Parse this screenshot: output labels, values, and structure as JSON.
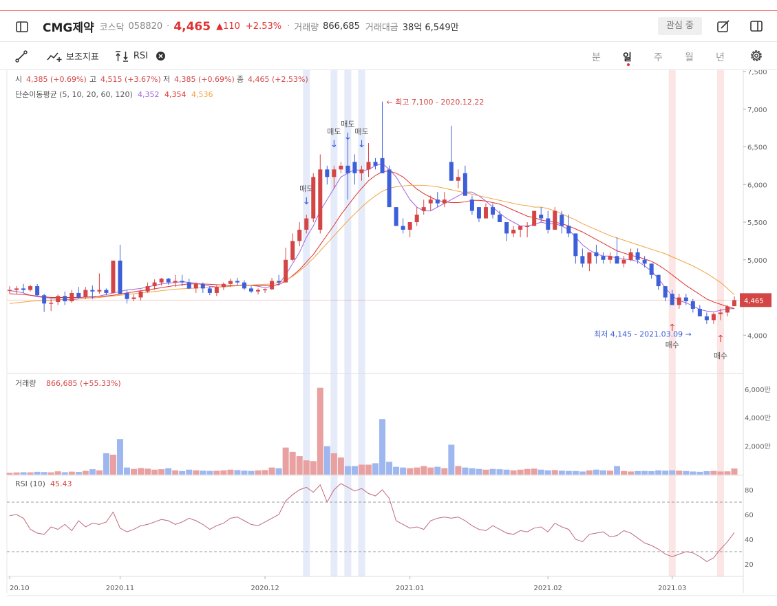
{
  "header": {
    "name": "CMG제약",
    "market": "코스닥",
    "code": "058820",
    "sep": "·",
    "price": "4,465",
    "change": "▲110",
    "change_pct": "+2.53%",
    "sep2": "·",
    "volume_label": "거래량",
    "volume_value": "866,685",
    "amount_label": "거래대금",
    "amount_value": "38억 6,549만",
    "interest_label": "관심 중"
  },
  "toolbar": {
    "indicator_label": "보조지표",
    "rsi_label": "RSI",
    "periods": [
      "분",
      "일",
      "주",
      "월",
      "년"
    ],
    "active_period": "일"
  },
  "ohlc_line": {
    "open_label": "시",
    "open_value": "4,385 (+0.69%)",
    "high_label": "고",
    "high_value": "4,515 (+3.67%)",
    "low_label": "저",
    "low_value": "4,385 (+0.69%)",
    "close_label": "종",
    "close_value": "4,465 (+2.53%)"
  },
  "ma_line": {
    "label": "단순이동평균 (5, 10, 20, 60, 120)",
    "values": [
      "4,352",
      "4,354",
      "4,536"
    ],
    "colors": [
      "#a064e0",
      "#e03131",
      "#f0a440"
    ]
  },
  "volume_header": {
    "label": "거래량",
    "value": "866,685 (+55.33%)"
  },
  "rsi_header": {
    "label": "RSI (10)",
    "value": "45.43"
  },
  "chart_data": {
    "type": "candlestick",
    "price_axis": {
      "ticks": [
        4000,
        4500,
        5000,
        5500,
        6000,
        6500,
        7000,
        7500
      ],
      "tick_labels": [
        "4,000",
        "4,500",
        "5,000",
        "5,500",
        "6,000",
        "6,500",
        "7,000",
        "7,500"
      ],
      "range": [
        3500,
        7500
      ],
      "current_label": "4,465"
    },
    "volume_axis": {
      "ticks": [
        2000,
        4000,
        6000
      ],
      "tick_labels": [
        "2,000만",
        "4,000만",
        "6,000만"
      ],
      "range": [
        0,
        7100
      ]
    },
    "rsi_axis": {
      "ticks": [
        20,
        40,
        60,
        80
      ],
      "tick_labels": [
        "20",
        "40",
        "60",
        "80"
      ],
      "range": [
        10,
        90
      ],
      "bands": [
        30,
        70
      ]
    },
    "x_labels": [
      {
        "i": 0,
        "text": "20.10"
      },
      {
        "i": 16,
        "text": "2020.11"
      },
      {
        "i": 37,
        "text": "2020.12"
      },
      {
        "i": 58,
        "text": "2021.01"
      },
      {
        "i": 78,
        "text": "2021.02"
      },
      {
        "i": 96,
        "text": "2021.03"
      }
    ],
    "candles": [
      [
        4600,
        4650,
        4550,
        4600,
        120
      ],
      [
        4600,
        4650,
        4550,
        4620,
        150
      ],
      [
        4620,
        4680,
        4560,
        4600,
        170
      ],
      [
        4600,
        4670,
        4580,
        4650,
        160
      ],
      [
        4650,
        4680,
        4520,
        4530,
        200
      ],
      [
        4530,
        4550,
        4310,
        4420,
        180
      ],
      [
        4420,
        4480,
        4320,
        4430,
        160
      ],
      [
        4440,
        4540,
        4400,
        4520,
        230
      ],
      [
        4520,
        4580,
        4400,
        4450,
        170
      ],
      [
        4450,
        4600,
        4430,
        4560,
        210
      ],
      [
        4560,
        4640,
        4490,
        4500,
        190
      ],
      [
        4500,
        4640,
        4480,
        4600,
        260
      ],
      [
        4600,
        4660,
        4480,
        4580,
        380
      ],
      [
        4580,
        4820,
        4550,
        4600,
        300
      ],
      [
        4600,
        4620,
        4530,
        4560,
        1500
      ],
      [
        4560,
        4900,
        4550,
        4990,
        1400
      ],
      [
        4990,
        5200,
        4550,
        4550,
        2500
      ],
      [
        4560,
        4600,
        4420,
        4480,
        500
      ],
      [
        4480,
        4540,
        4450,
        4500,
        400
      ],
      [
        4500,
        4600,
        4460,
        4580,
        460
      ],
      [
        4580,
        4700,
        4560,
        4650,
        420
      ],
      [
        4650,
        4740,
        4600,
        4700,
        350
      ],
      [
        4700,
        4760,
        4660,
        4750,
        380
      ],
      [
        4750,
        4760,
        4670,
        4700,
        450
      ],
      [
        4700,
        4800,
        4640,
        4720,
        300
      ],
      [
        4720,
        4800,
        4650,
        4700,
        250
      ],
      [
        4700,
        4750,
        4610,
        4620,
        350
      ],
      [
        4620,
        4700,
        4560,
        4680,
        300
      ],
      [
        4680,
        4700,
        4560,
        4620,
        280
      ],
      [
        4620,
        4650,
        4530,
        4560,
        260
      ],
      [
        4560,
        4660,
        4520,
        4640,
        270
      ],
      [
        4640,
        4700,
        4600,
        4680,
        300
      ],
      [
        4680,
        4750,
        4640,
        4720,
        350
      ],
      [
        4720,
        4760,
        4660,
        4700,
        320
      ],
      [
        4700,
        4730,
        4600,
        4620,
        280
      ],
      [
        4620,
        4650,
        4560,
        4580,
        260
      ],
      [
        4580,
        4620,
        4540,
        4600,
        300
      ],
      [
        4600,
        4620,
        4560,
        4610,
        320
      ],
      [
        4610,
        4760,
        4600,
        4720,
        500
      ],
      [
        4720,
        4800,
        4660,
        4700,
        450
      ],
      [
        4700,
        5160,
        4700,
        5000,
        1900
      ],
      [
        5000,
        5350,
        4980,
        5250,
        1600
      ],
      [
        5250,
        5500,
        5180,
        5400,
        1300
      ],
      [
        5400,
        5600,
        5350,
        5550,
        1000
      ],
      [
        5550,
        6150,
        5500,
        6100,
        950
      ],
      [
        5400,
        6400,
        5350,
        6200,
        6100
      ],
      [
        6200,
        6250,
        6000,
        6100,
        2000
      ],
      [
        6100,
        6250,
        5950,
        6200,
        1500
      ],
      [
        6200,
        6300,
        6150,
        6250,
        1200
      ],
      [
        6250,
        6650,
        5800,
        6150,
        600
      ],
      [
        6300,
        6400,
        6000,
        6150,
        600
      ],
      [
        6150,
        6250,
        6050,
        6200,
        700
      ],
      [
        6200,
        6550,
        6100,
        6300,
        700
      ],
      [
        6300,
        6350,
        6200,
        6250,
        800
      ],
      [
        6350,
        7100,
        6150,
        6150,
        3900
      ],
      [
        6200,
        6250,
        5700,
        5700,
        900
      ],
      [
        5700,
        5700,
        5450,
        5450,
        550
      ],
      [
        5450,
        5550,
        5350,
        5400,
        500
      ],
      [
        5400,
        5500,
        5300,
        5500,
        450
      ],
      [
        5500,
        5700,
        5450,
        5600,
        500
      ],
      [
        5650,
        5800,
        5600,
        5700,
        600
      ],
      [
        5750,
        5850,
        5650,
        5800,
        500
      ],
      [
        5800,
        5900,
        5700,
        5750,
        550
      ],
      [
        5750,
        5900,
        5700,
        5800,
        450
      ],
      [
        6300,
        6780,
        6300,
        6050,
        2100
      ],
      [
        6050,
        6200,
        5950,
        6100,
        600
      ],
      [
        6150,
        6250,
        5850,
        5850,
        500
      ],
      [
        5800,
        5850,
        5600,
        5650,
        450
      ],
      [
        5700,
        5700,
        5500,
        5550,
        400
      ],
      [
        5550,
        5750,
        5550,
        5700,
        350
      ],
      [
        5700,
        5750,
        5550,
        5600,
        400
      ],
      [
        5600,
        5650,
        5500,
        5500,
        380
      ],
      [
        5500,
        5500,
        5250,
        5350,
        350
      ],
      [
        5350,
        5450,
        5300,
        5400,
        300
      ],
      [
        5400,
        5450,
        5300,
        5450,
        350
      ],
      [
        5450,
        5500,
        5300,
        5450,
        400
      ],
      [
        5450,
        5650,
        5450,
        5650,
        420
      ],
      [
        5600,
        5700,
        5500,
        5550,
        350
      ],
      [
        5550,
        5650,
        5350,
        5400,
        300
      ],
      [
        5400,
        5700,
        5400,
        5650,
        320
      ],
      [
        5600,
        5650,
        5350,
        5450,
        280
      ],
      [
        5450,
        5600,
        5300,
        5350,
        260
      ],
      [
        5350,
        5350,
        4950,
        5050,
        250
      ],
      [
        5050,
        5150,
        4900,
        4950,
        220
      ],
      [
        4950,
        5100,
        4850,
        5100,
        300
      ],
      [
        5100,
        5200,
        4950,
        5050,
        350
      ],
      [
        5050,
        5100,
        4950,
        5000,
        300
      ],
      [
        5000,
        5100,
        4950,
        5050,
        280
      ],
      [
        5050,
        5300,
        4950,
        4950,
        600
      ],
      [
        4950,
        5050,
        4900,
        5000,
        250
      ],
      [
        5000,
        5150,
        4980,
        5100,
        220
      ],
      [
        5100,
        5150,
        4950,
        5000,
        250
      ],
      [
        5000,
        5050,
        4900,
        4950,
        260
      ],
      [
        4950,
        4950,
        4750,
        4800,
        240
      ],
      [
        4800,
        4800,
        4600,
        4650,
        300
      ],
      [
        4650,
        4650,
        4450,
        4500,
        280
      ],
      [
        4550,
        4600,
        4400,
        4400,
        300
      ],
      [
        4400,
        4550,
        4350,
        4500,
        280
      ],
      [
        4500,
        4550,
        4400,
        4450,
        250
      ],
      [
        4450,
        4480,
        4300,
        4350,
        220
      ],
      [
        4350,
        4400,
        4250,
        4250,
        200
      ],
      [
        4250,
        4300,
        4150,
        4200,
        240
      ],
      [
        4200,
        4300,
        4150,
        4280,
        260
      ],
      [
        4280,
        4350,
        4200,
        4300,
        220
      ],
      [
        4300,
        4400,
        4250,
        4380,
        230
      ],
      [
        4385,
        4515,
        4385,
        4465,
        430
      ]
    ],
    "ma5": [
      4590,
      4580,
      4560,
      4530,
      4510,
      4500,
      4490,
      4480,
      4470,
      4470,
      4480,
      4490,
      4500,
      4520,
      4540,
      4560,
      4580,
      4600,
      4610,
      4620,
      4640,
      4660,
      4680,
      4690,
      4700,
      4710,
      4700,
      4690,
      4670,
      4650,
      4640,
      4640,
      4650,
      4660,
      4670,
      4660,
      4650,
      4630,
      4650,
      4680,
      4800,
      4950,
      5100,
      5300,
      5450,
      5650,
      5800,
      5950,
      6100,
      6150,
      6200,
      6180,
      6200,
      6250,
      6280,
      6200,
      6100,
      5950,
      5800,
      5700,
      5650,
      5650,
      5700,
      5750,
      5800,
      5850,
      5900,
      5900,
      5850,
      5780,
      5700,
      5620,
      5550,
      5500,
      5450,
      5450,
      5470,
      5500,
      5480,
      5480,
      5450,
      5400,
      5300,
      5200,
      5130,
      5080,
      5050,
      5050,
      5020,
      5010,
      5000,
      4980,
      4920,
      4850,
      4750,
      4630,
      4520,
      4460,
      4430,
      4390,
      4340,
      4320,
      4310,
      4330,
      4350,
      4352
    ],
    "ma10": [
      4550,
      4545,
      4540,
      4530,
      4520,
      4510,
      4500,
      4500,
      4500,
      4500,
      4500,
      4505,
      4510,
      4515,
      4520,
      4530,
      4545,
      4560,
      4575,
      4590,
      4600,
      4615,
      4630,
      4645,
      4660,
      4670,
      4680,
      4680,
      4680,
      4675,
      4670,
      4665,
      4660,
      4660,
      4660,
      4660,
      4660,
      4655,
      4660,
      4670,
      4720,
      4790,
      4870,
      4970,
      5070,
      5200,
      5330,
      5460,
      5600,
      5720,
      5840,
      5950,
      6050,
      6120,
      6170,
      6180,
      6150,
      6100,
      6020,
      5940,
      5880,
      5830,
      5790,
      5770,
      5760,
      5760,
      5770,
      5790,
      5790,
      5780,
      5760,
      5740,
      5700,
      5660,
      5620,
      5580,
      5560,
      5530,
      5510,
      5500,
      5480,
      5450,
      5410,
      5370,
      5320,
      5270,
      5220,
      5170,
      5120,
      5090,
      5060,
      5040,
      5010,
      4980,
      4930,
      4870,
      4800,
      4730,
      4660,
      4600,
      4540,
      4480,
      4440,
      4410,
      4380,
      4354
    ],
    "ma20": [
      4420,
      4430,
      4440,
      4450,
      4455,
      4460,
      4465,
      4470,
      4475,
      4480,
      4485,
      4490,
      4495,
      4500,
      4510,
      4520,
      4530,
      4540,
      4550,
      4560,
      4570,
      4580,
      4590,
      4600,
      4610,
      4615,
      4620,
      4625,
      4630,
      4635,
      4640,
      4645,
      4650,
      4655,
      4660,
      4665,
      4670,
      4675,
      4680,
      4700,
      4730,
      4780,
      4850,
      4930,
      5020,
      5120,
      5220,
      5320,
      5420,
      5520,
      5610,
      5700,
      5780,
      5850,
      5910,
      5950,
      5970,
      5980,
      5990,
      5990,
      5990,
      5980,
      5970,
      5950,
      5930,
      5910,
      5890,
      5870,
      5850,
      5830,
      5810,
      5790,
      5770,
      5750,
      5730,
      5720,
      5700,
      5700,
      5680,
      5650,
      5610,
      5570,
      5530,
      5480,
      5440,
      5400,
      5360,
      5320,
      5290,
      5260,
      5230,
      5200,
      5170,
      5140,
      5110,
      5080,
      5040,
      5000,
      4960,
      4920,
      4870,
      4820,
      4760,
      4700,
      4620,
      4536
    ],
    "rsi": [
      59,
      60,
      57,
      48,
      45,
      44,
      50,
      48,
      52,
      47,
      55,
      50,
      53,
      52,
      54,
      62,
      49,
      46,
      48,
      51,
      52,
      54,
      56,
      55,
      52,
      54,
      57,
      55,
      52,
      48,
      51,
      53,
      57,
      58,
      55,
      52,
      51,
      54,
      57,
      60,
      71,
      76,
      80,
      82,
      78,
      84,
      70,
      80,
      85,
      82,
      79,
      81,
      77,
      75,
      80,
      73,
      55,
      52,
      49,
      50,
      48,
      55,
      57,
      58,
      57,
      58,
      55,
      51,
      48,
      47,
      51,
      48,
      45,
      44,
      47,
      46,
      49,
      50,
      46,
      53,
      50,
      48,
      40,
      38,
      44,
      45,
      46,
      42,
      43,
      47,
      45,
      41,
      37,
      35,
      32,
      28,
      26,
      28,
      30,
      29,
      26,
      22,
      25,
      32,
      38,
      45.43
    ],
    "annotations": {
      "high": "← 최고 7,100 - 2020.12.22",
      "low": "최저 4,145 - 2021.03.09 →",
      "sells": [
        {
          "i": 43,
          "text": "매도",
          "arrow": "↓"
        },
        {
          "i": 47,
          "text": "매도",
          "arrow": "↓"
        },
        {
          "i": 49,
          "text": "매도",
          "arrow": "↓"
        },
        {
          "i": 51,
          "text": "매도",
          "arrow": "↓"
        }
      ],
      "buys": [
        {
          "i": 96,
          "text": "매수",
          "arrow": "↑"
        },
        {
          "i": 103,
          "text": "매수",
          "arrow": "↑"
        }
      ]
    },
    "colors": {
      "up": "#d44545",
      "down": "#3d5fd8",
      "vol_up": "#e8a0a0",
      "vol_down": "#9fb7ef",
      "rsi_line": "#c0687a",
      "sell_band": "#e6ebfa",
      "buy_band": "#fbe5e5",
      "current_bg": "#d44545"
    }
  }
}
